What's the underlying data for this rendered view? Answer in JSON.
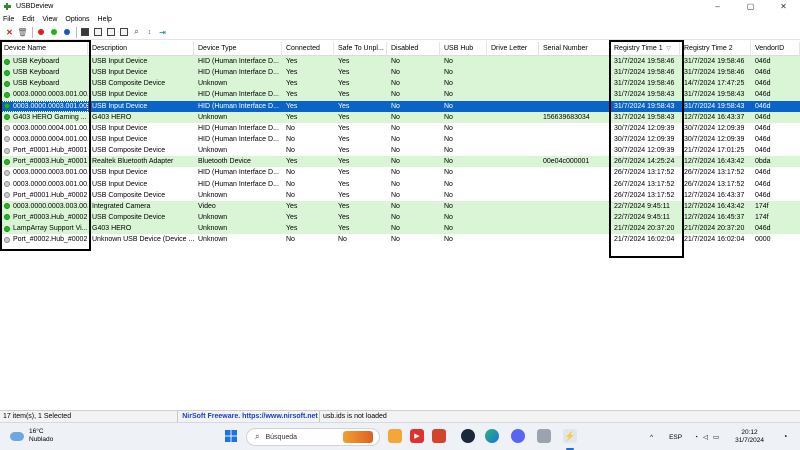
{
  "window": {
    "title": "USBDeview",
    "minimize": "–",
    "maximize": "▢",
    "close": "✕"
  },
  "menu": [
    "File",
    "Edit",
    "View",
    "Options",
    "Help"
  ],
  "columns": [
    "Device Name",
    "Description",
    "Device Type",
    "Connected",
    "Safe To Unpl...",
    "Disabled",
    "USB Hub",
    "Drive Letter",
    "Serial Number",
    "Registry Time 1",
    "Registry Time 2",
    "VendorID"
  ],
  "sort_indicator": "▽",
  "rows": [
    {
      "state": "on",
      "highlight": "green",
      "cells": [
        "USB Keyboard",
        "USB Input Device",
        "HID (Human Interface D...",
        "Yes",
        "Yes",
        "No",
        "No",
        "",
        "",
        "31/7/2024 19:58:46",
        "31/7/2024 19:58:46",
        "046d"
      ]
    },
    {
      "state": "on",
      "highlight": "green",
      "cells": [
        "USB Keyboard",
        "USB Input Device",
        "HID (Human Interface D...",
        "Yes",
        "Yes",
        "No",
        "No",
        "",
        "",
        "31/7/2024 19:58:46",
        "31/7/2024 19:58:46",
        "046d"
      ]
    },
    {
      "state": "on",
      "highlight": "green",
      "cells": [
        "USB Keyboard",
        "USB Composite Device",
        "Unknown",
        "Yes",
        "Yes",
        "No",
        "No",
        "",
        "",
        "31/7/2024 19:58:46",
        "14/7/2024 17:47:25",
        "046d"
      ]
    },
    {
      "state": "on",
      "highlight": "green",
      "cells": [
        "0003.0000.0003.001.00...",
        "USB Input Device",
        "HID (Human Interface D...",
        "Yes",
        "Yes",
        "No",
        "No",
        "",
        "",
        "31/7/2024 19:58:43",
        "31/7/2024 19:58:43",
        "046d"
      ]
    },
    {
      "state": "on",
      "highlight": "selected",
      "cells": [
        "0003.0000.0003.001.00...",
        "USB Input Device",
        "HID (Human Interface D...",
        "Yes",
        "Yes",
        "No",
        "No",
        "",
        "",
        "31/7/2024 19:58:43",
        "31/7/2024 19:58:43",
        "046d"
      ]
    },
    {
      "state": "on",
      "highlight": "green",
      "cells": [
        "G403 HERO Gaming ...",
        "G403 HERO",
        "Unknown",
        "Yes",
        "Yes",
        "No",
        "No",
        "",
        "156639683034",
        "31/7/2024 19:58:43",
        "12/7/2024 16:43:37",
        "046d"
      ]
    },
    {
      "state": "off",
      "highlight": "none",
      "cells": [
        "0003.0000.0004.001.00...",
        "USB Input Device",
        "HID (Human Interface D...",
        "No",
        "Yes",
        "No",
        "No",
        "",
        "",
        "30/7/2024 12:09:39",
        "30/7/2024 12:09:39",
        "046d"
      ]
    },
    {
      "state": "off",
      "highlight": "none",
      "cells": [
        "0003.0000.0004.001.00...",
        "USB Input Device",
        "HID (Human Interface D...",
        "No",
        "Yes",
        "No",
        "No",
        "",
        "",
        "30/7/2024 12:09:39",
        "30/7/2024 12:09:39",
        "046d"
      ]
    },
    {
      "state": "off",
      "highlight": "none",
      "cells": [
        "Port_#0001.Hub_#0001",
        "USB Composite Device",
        "Unknown",
        "No",
        "Yes",
        "No",
        "No",
        "",
        "",
        "30/7/2024 12:09:39",
        "21/7/2024 17:01:25",
        "046d"
      ]
    },
    {
      "state": "on",
      "highlight": "green",
      "cells": [
        "Port_#0003.Hub_#0001",
        "Realtek Bluetooth Adapter",
        "Bluetooth Device",
        "Yes",
        "Yes",
        "No",
        "No",
        "",
        "00e04c000001",
        "26/7/2024 14:25:24",
        "12/7/2024 16:43:42",
        "0bda"
      ]
    },
    {
      "state": "off",
      "highlight": "none",
      "cells": [
        "0003.0000.0003.001.00...",
        "USB Input Device",
        "HID (Human Interface D...",
        "No",
        "Yes",
        "No",
        "No",
        "",
        "",
        "26/7/2024 13:17:52",
        "26/7/2024 13:17:52",
        "046d"
      ]
    },
    {
      "state": "off",
      "highlight": "none",
      "cells": [
        "0003.0000.0003.001.00...",
        "USB Input Device",
        "HID (Human Interface D...",
        "No",
        "Yes",
        "No",
        "No",
        "",
        "",
        "26/7/2024 13:17:52",
        "26/7/2024 13:17:52",
        "046d"
      ]
    },
    {
      "state": "off",
      "highlight": "none",
      "cells": [
        "Port_#0001.Hub_#0002",
        "USB Composite Device",
        "Unknown",
        "No",
        "Yes",
        "No",
        "No",
        "",
        "",
        "26/7/2024 13:17:52",
        "12/7/2024 16:43:37",
        "046d"
      ]
    },
    {
      "state": "on",
      "highlight": "green",
      "cells": [
        "0003.0000.0003.003.00...",
        "Integrated Camera",
        "Video",
        "Yes",
        "Yes",
        "No",
        "No",
        "",
        "",
        "22/7/2024 9:45:11",
        "12/7/2024 16:43:42",
        "174f"
      ]
    },
    {
      "state": "on",
      "highlight": "green",
      "cells": [
        "Port_#0003.Hub_#0002",
        "USB Composite Device",
        "Unknown",
        "Yes",
        "Yes",
        "No",
        "No",
        "",
        "",
        "22/7/2024 9:45:11",
        "12/7/2024 16:45:37",
        "174f"
      ]
    },
    {
      "state": "on",
      "highlight": "green",
      "cells": [
        "LampArray Support Vi...",
        "G403 HERO",
        "Unknown",
        "Yes",
        "Yes",
        "No",
        "No",
        "",
        "",
        "21/7/2024 20:37:20",
        "21/7/2024 20:37:20",
        "046d"
      ]
    },
    {
      "state": "off",
      "highlight": "none",
      "cells": [
        "Port_#0002.Hub_#0002",
        "Unknown USB Device (Device ...",
        "Unknown",
        "No",
        "No",
        "No",
        "No",
        "",
        "",
        "21/7/2024 16:02:04",
        "21/7/2024 16:02:04",
        "0000"
      ]
    }
  ],
  "status": {
    "count": "17 item(s), 1 Selected",
    "nirsoft": "NirSoft Freeware.  https://www.nirsoft.net",
    "ids": "usb.ids is not loaded"
  },
  "taskbar": {
    "temperature": "16°C",
    "weather": "Nublado",
    "search_placeholder": "Búsqueda",
    "language": "ESP",
    "time": "20:12",
    "date": "31/7/2024",
    "chevron": "^"
  }
}
